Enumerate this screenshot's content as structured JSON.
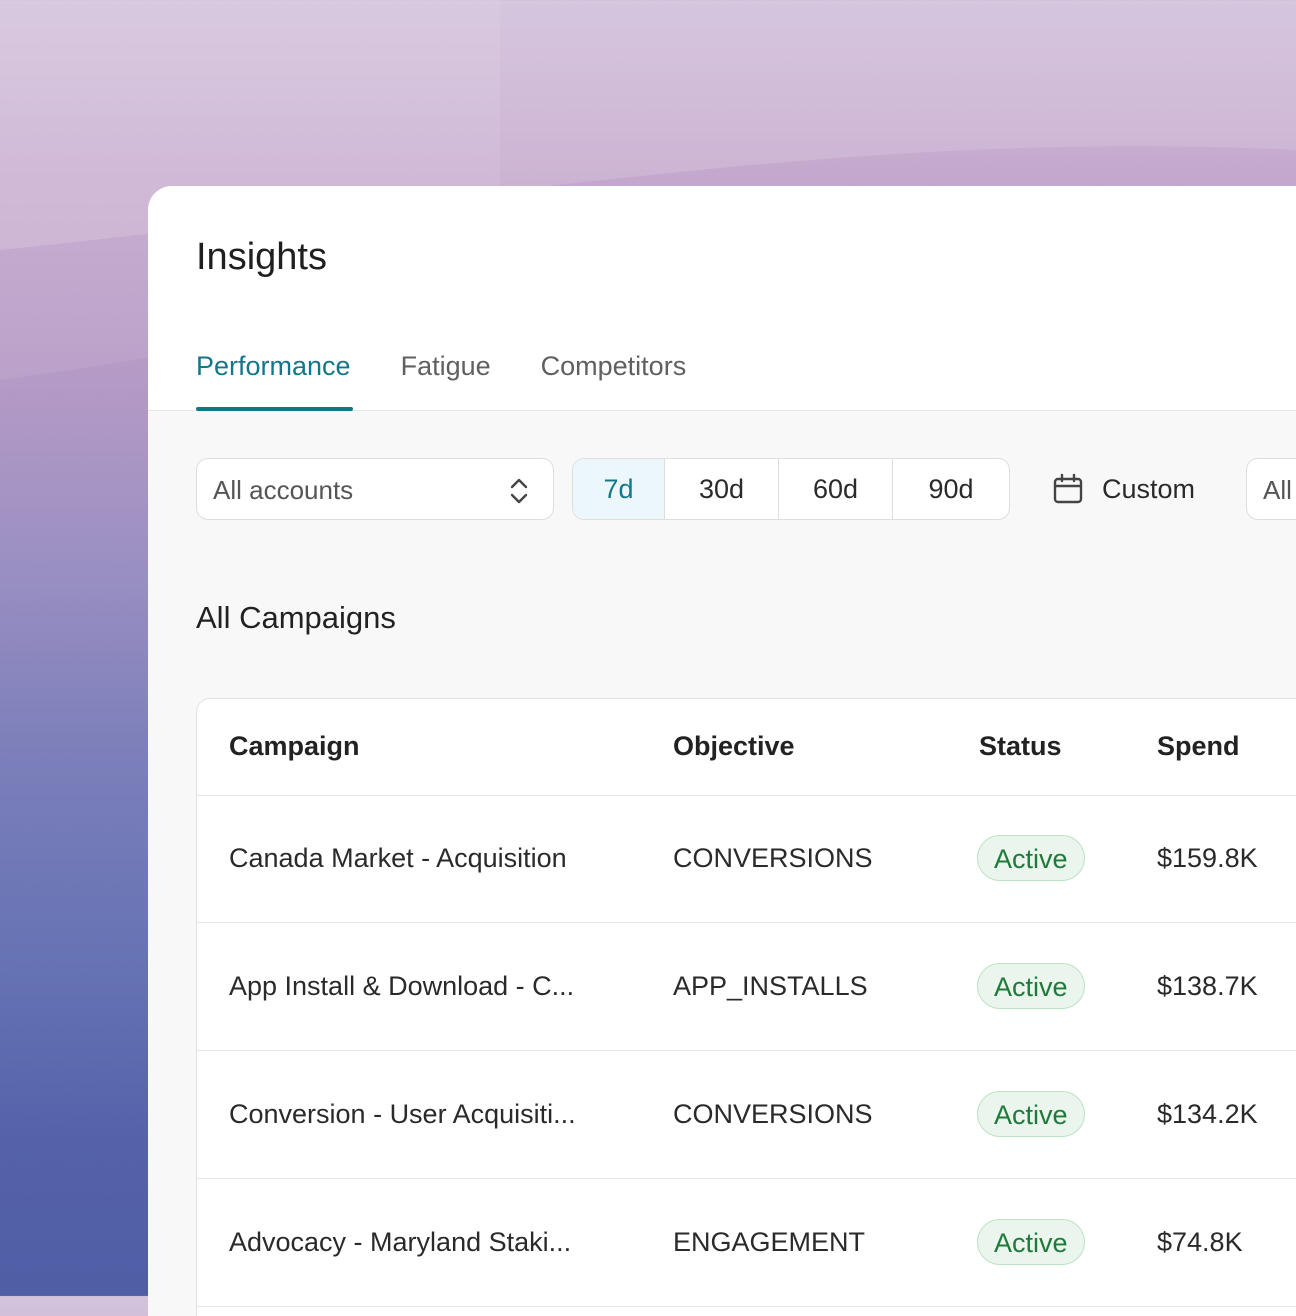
{
  "page": {
    "title": "Insights"
  },
  "tabs": [
    {
      "label": "Performance",
      "active": true
    },
    {
      "label": "Fatigue",
      "active": false
    },
    {
      "label": "Competitors",
      "active": false
    }
  ],
  "filters": {
    "account_select": {
      "value": "All accounts",
      "icon": "chevron-up-down-icon"
    },
    "ranges": [
      {
        "label": "7d",
        "selected": true
      },
      {
        "label": "30d",
        "selected": false
      },
      {
        "label": "60d",
        "selected": false
      },
      {
        "label": "90d",
        "selected": false
      }
    ],
    "custom": {
      "label": "Custom",
      "icon": "calendar-icon"
    },
    "all_select": {
      "value": "All"
    }
  },
  "section": {
    "title": "All Campaigns"
  },
  "table": {
    "columns": [
      "Campaign",
      "Objective",
      "Status",
      "Spend"
    ],
    "rows": [
      {
        "campaign": "Canada Market - Acquisition",
        "objective": "CONVERSIONS",
        "status": "Active",
        "spend": "$159.8K"
      },
      {
        "campaign": "App Install & Download - C...",
        "objective": "APP_INSTALLS",
        "status": "Active",
        "spend": "$138.7K"
      },
      {
        "campaign": "Conversion - User Acquisiti...",
        "objective": "CONVERSIONS",
        "status": "Active",
        "spend": "$134.2K"
      },
      {
        "campaign": "Advocacy - Maryland Staki...",
        "objective": "ENGAGEMENT",
        "status": "Active",
        "spend": "$74.8K"
      }
    ]
  },
  "colors": {
    "accent": "#137789",
    "status_active_text": "#1f7a3a",
    "status_active_bg": "#eaf6ed"
  }
}
